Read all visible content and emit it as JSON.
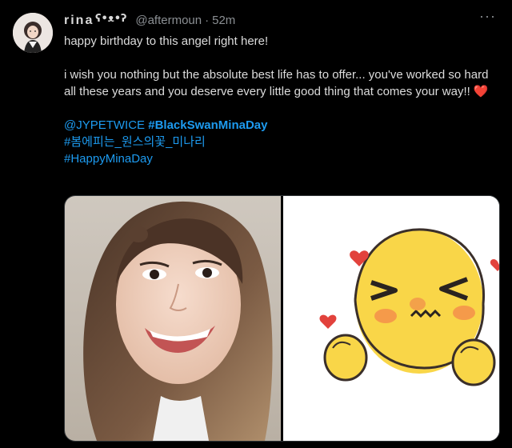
{
  "tweet": {
    "display_name": "rina",
    "handle": "@aftermoun",
    "separator": "·",
    "time": "52m",
    "more_label": "···",
    "line1": "happy birthday to this angel right here!",
    "line2": "i wish you nothing but the absolute best life has to offer... you've worked so hard all these years and you deserve every little good thing that comes your way!!",
    "heart": "❤️",
    "mention": "@JYPETWICE",
    "hashtag1": "#BlackSwanMinaDay",
    "hashtag2": "#봄에피는_원스의꽃_미나리",
    "hashtag3": "#HappyMinaDay"
  },
  "icons": {
    "avatar": "profile-avatar",
    "name_emoji": "bear-face-kaomoji",
    "photo_left": "portrait-photo",
    "photo_right": "cute-emoji-drawing"
  },
  "colors": {
    "background": "#000000",
    "text": "#d9d9d9",
    "muted": "#8b8f93",
    "link": "#1d9bf0",
    "heart": "#e0245e"
  }
}
